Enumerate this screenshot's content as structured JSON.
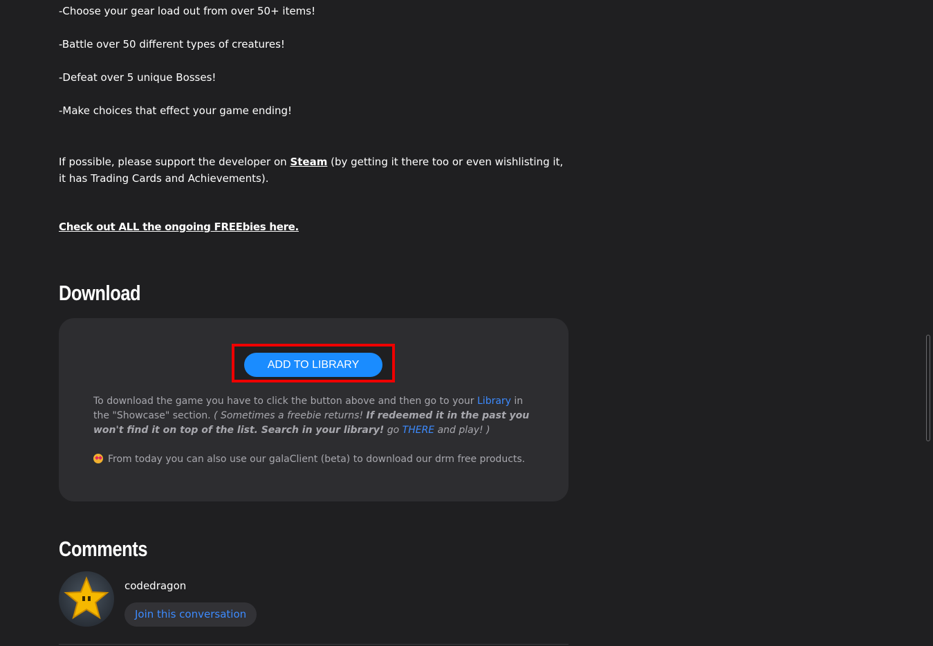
{
  "features": [
    "-Choose your gear load out from over 50+ items!",
    "-Battle over 50 different types of creatures!",
    "-Defeat over 5 unique Bosses!",
    "-Make choices that effect your game ending!"
  ],
  "support": {
    "prefix": "If possible, please support the developer on ",
    "link": "Steam",
    "suffix": " (by getting it there too or even wishlisting it, it has Trading Cards and Achievements)."
  },
  "freebies_link": "Check out ALL the ongoing FREEbies here.",
  "download": {
    "heading": "Download",
    "button_label": "ADD TO LIBRARY",
    "text_part1": "To download the game you have to click the button above and then go to your ",
    "library_link": "Library",
    "text_part2": " in the \"Showcase\" section. ",
    "italic_part1": "( Sometimes a freebie returns! ",
    "bold_italic": "If redeemed it in the past you won't find it on top of the list. Search in your library!",
    "italic_part2": " go ",
    "there_link": "THERE",
    "italic_part3": " and play! )",
    "note_prefix": "From today you can also use our ",
    "galaclient_link": "galaClient (beta)",
    "note_suffix": " to download our drm free products.",
    "note_icon": "star-struck-emoji-icon"
  },
  "comments": {
    "heading": "Comments",
    "username": "codedragon",
    "join_label": "Join this conversation",
    "avatar_icon": "pixel-star-icon"
  },
  "colors": {
    "background": "#1f1f21",
    "box": "#2d2d30",
    "accent_blue": "#1a8cff",
    "link_blue": "#3d8bff",
    "highlight_red": "#ee0000"
  }
}
